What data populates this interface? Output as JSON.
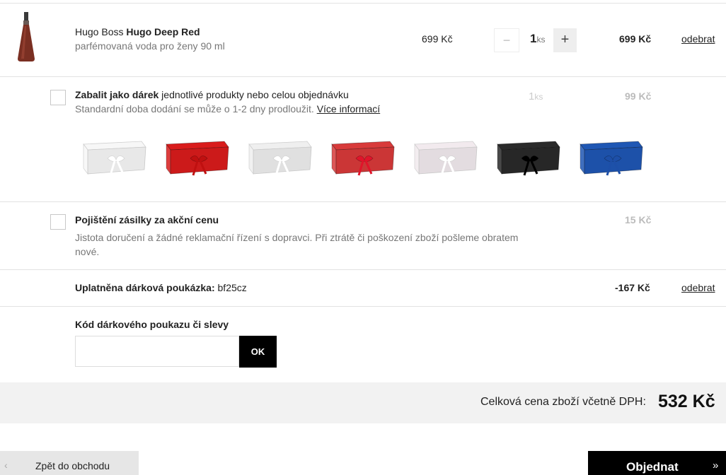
{
  "product": {
    "brand": "Hugo Boss",
    "name": "Hugo Deep Red",
    "subtitle": "parfémovaná voda pro ženy 90 ml",
    "unit_price": "699 Kč",
    "qty_minus": "−",
    "qty": "1",
    "qty_unit": "ks",
    "qty_plus": "+",
    "total": "699 Kč",
    "remove_label": "odebrat"
  },
  "gift_wrap": {
    "title_bold": "Zabalit jako dárek",
    "title_rest": " jednotlivé produkty nebo celou objednávku",
    "subtitle": "Standardní doba dodání se může o 1-2 dny prodloužit. ",
    "more_info": "Více informací",
    "qty": "1",
    "qty_unit": "ks",
    "price": "99 Kč",
    "box_colors": [
      "#f7f7f7",
      "#d91c1c",
      "#efefef",
      "#d83a3a",
      "#f2eaee",
      "#2a2a2a",
      "#1f57b4"
    ],
    "ribbon_colors": [
      "#ffffff",
      "#c01010",
      "#ffffff",
      "#e0142a",
      "#ffffff",
      "#000000",
      "#1d4fa8"
    ]
  },
  "insurance": {
    "title": "Pojištění zásilky za akční cenu",
    "description": "Jistota doručení a žádné reklamační řízení s dopravci. Při ztrátě či poškození zboží pošleme obratem nové.",
    "price": "15 Kč"
  },
  "voucher": {
    "label_bold": "Uplatněna dárková poukázka:",
    "code": " bf25cz",
    "amount": "-167 Kč",
    "remove_label": "odebrat"
  },
  "code_entry": {
    "label": "Kód dárkového poukazu či slevy",
    "value": "",
    "ok_label": "OK"
  },
  "total": {
    "label": "Celková cena zboží včetně DPH:",
    "value": "532 Kč"
  },
  "footer": {
    "back_arrow": "‹",
    "back_label": "Zpět do obchodu",
    "order_label": "Objednat",
    "order_arrow": "»"
  }
}
